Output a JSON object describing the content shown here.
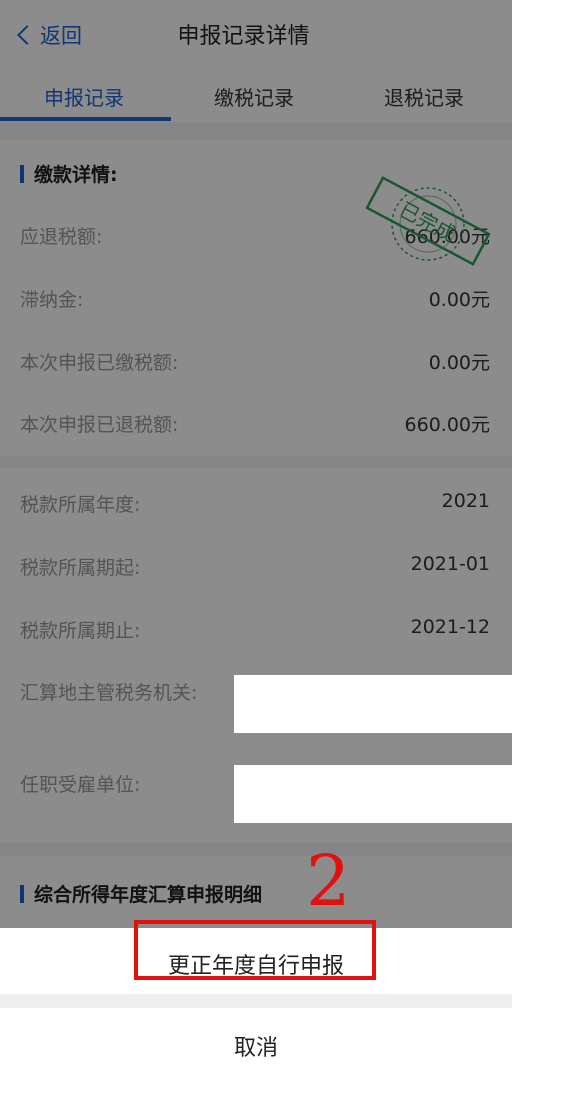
{
  "navbar": {
    "back": "返回",
    "title": "申报记录详情"
  },
  "tabs": [
    {
      "label": "申报记录",
      "active": true
    },
    {
      "label": "缴税记录",
      "active": false
    },
    {
      "label": "退税记录",
      "active": false
    }
  ],
  "payment": {
    "heading": "缴款详情:",
    "stamp": "已完成",
    "rows": [
      {
        "label": "应退税额:",
        "value": "660.00元"
      },
      {
        "label": "滞纳金:",
        "value": "0.00元"
      },
      {
        "label": "本次申报已缴税额:",
        "value": "0.00元"
      },
      {
        "label": "本次申报已退税额:",
        "value": "660.00元"
      }
    ]
  },
  "period": {
    "rows": [
      {
        "label": "税款所属年度:",
        "value": "2021"
      },
      {
        "label": "税款所属期起:",
        "value": "2021-01"
      },
      {
        "label": "税款所属期止:",
        "value": "2021-12"
      },
      {
        "label": "汇算地主管税务机关:",
        "value": ""
      },
      {
        "label": "任职受雇单位:",
        "value": ""
      }
    ]
  },
  "detail": {
    "heading": "综合所得年度汇算申报明细"
  },
  "action_sheet": {
    "primary": "更正年度自行申报",
    "cancel": "取消"
  },
  "annotation": {
    "step": "2"
  },
  "colors": {
    "accent": "#1e63d6",
    "marker": "#e31010",
    "stamp": "#2f9e5a"
  }
}
